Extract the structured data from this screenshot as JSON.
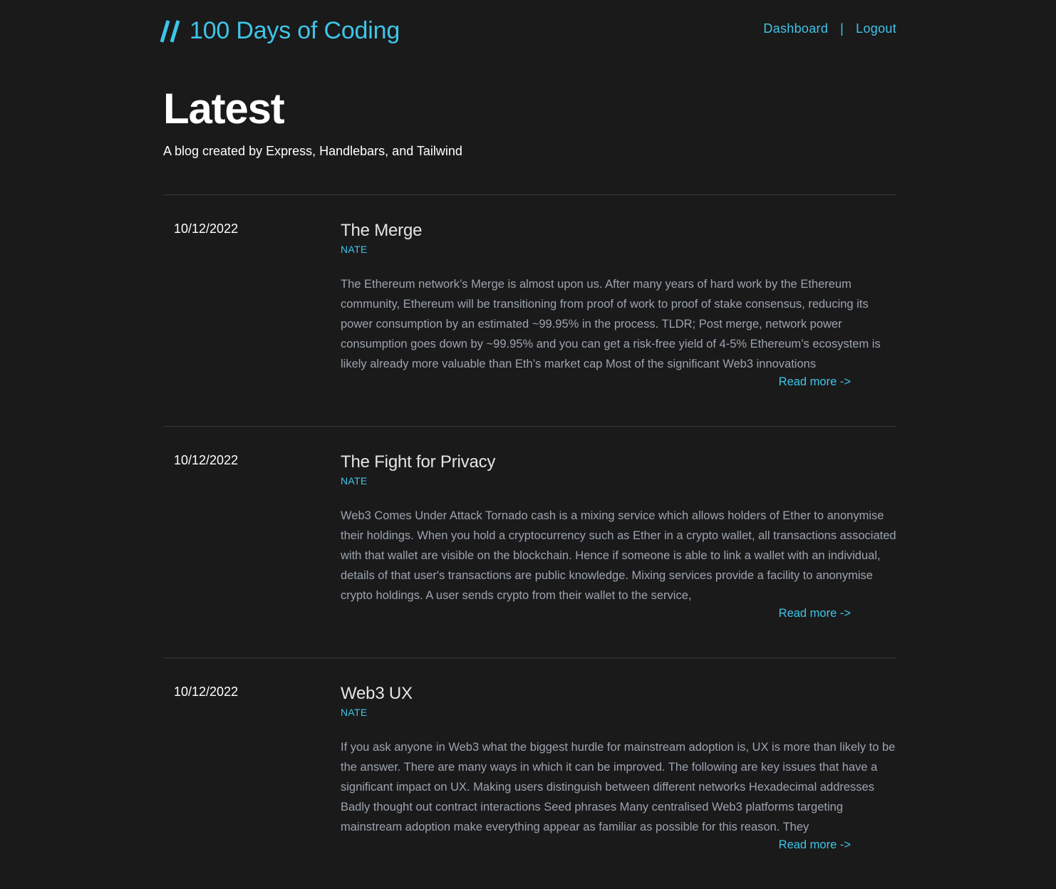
{
  "header": {
    "logo_mark": "//",
    "logo_text": "100 Days of Coding",
    "nav": {
      "dashboard": "Dashboard",
      "separator": "|",
      "logout": "Logout"
    }
  },
  "hero": {
    "title": "Latest",
    "subtitle": "A blog created by Express, Handlebars, and Tailwind"
  },
  "posts": [
    {
      "date": "10/12/2022",
      "title": "The Merge",
      "author": "NATE",
      "excerpt": "The Ethereum network’s Merge is almost upon us. After many years of hard work by the Ethereum community, Ethereum will be transitioning from proof of work to proof of stake consensus, reducing its power consumption by an estimated ~99.95% in the process. TLDR; Post merge, network power consumption goes down by ~99.95% and you can get a risk-free yield of 4-5% Ethereum’s ecosystem is likely already more valuable than Eth’s market cap Most of the significant Web3 innovations",
      "read_more": "Read more ->"
    },
    {
      "date": "10/12/2022",
      "title": "The Fight for Privacy",
      "author": "NATE",
      "excerpt": "Web3 Comes Under Attack Tornado cash is a mixing service which allows holders of Ether to anonymise their holdings. When you hold a cryptocurrency such as Ether in a crypto wallet, all transactions associated with that wallet are visible on the blockchain. Hence if someone is able to link a wallet with an individual, details of that user's transactions are public knowledge. Mixing services provide a facility to anonymise crypto holdings. A user sends crypto from their wallet to the service,",
      "read_more": "Read more ->"
    },
    {
      "date": "10/12/2022",
      "title": "Web3 UX",
      "author": "NATE",
      "excerpt": "If you ask anyone in Web3 what the biggest hurdle for mainstream adoption is, UX is more than likely to be the answer. There are many ways in which it can be improved. The following are key issues that have a significant impact on UX. Making users distinguish between different networks Hexadecimal addresses Badly thought out contract interactions Seed phrases Many centralised Web3 platforms targeting mainstream adoption make everything appear as familiar as possible for this reason. They",
      "read_more": "Read more ->"
    }
  ],
  "colors": {
    "background": "#1a1a1a",
    "accent": "#3ec5e8",
    "heading": "#ffffff",
    "post_title": "#e5e5e5",
    "excerpt": "#9ca3af",
    "divider": "#3a3a3a"
  }
}
